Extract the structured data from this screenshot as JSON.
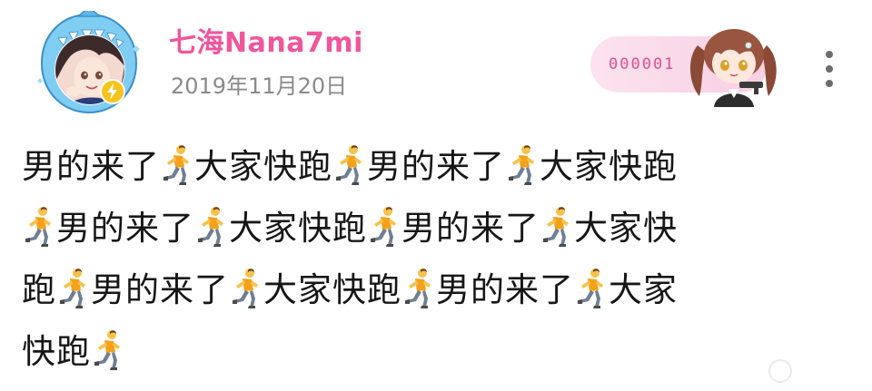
{
  "user": {
    "name": "七海Nana7mi",
    "date": "2019年11月20日",
    "avatar_icon": "avatar-icon",
    "frame_icon": "shark-avatar-frame-icon",
    "badge_icon": "lightning-verified-icon"
  },
  "decoration": {
    "number": "000001",
    "character_icon": "anime-girl-decoration-icon"
  },
  "menu": {
    "icon": "more-vertical-icon"
  },
  "content": {
    "phrase_a": "男的来了",
    "phrase_b": "大家快跑",
    "runner_icon": "runner-emoji-icon",
    "lines": [
      [
        "男的来了",
        "runner",
        "大家快跑",
        "runner",
        "男的来了",
        "runner",
        "大家快跑"
      ],
      [
        "runner",
        "男的来了",
        "runner",
        "大家快跑",
        "runner",
        "男的来了",
        "runner",
        "大家快"
      ],
      [
        "跑",
        "runner",
        "男的来了",
        "runner",
        "大家快跑",
        "runner",
        "男的来了",
        "runner",
        "大家"
      ],
      [
        "快跑",
        "runner"
      ]
    ]
  },
  "colors": {
    "name": "#f1559b",
    "date": "#8a8a8a",
    "text": "#161616",
    "deco_number": "#e24e8e",
    "frame": "#6ec3ef",
    "badge": "#f7c41b"
  }
}
